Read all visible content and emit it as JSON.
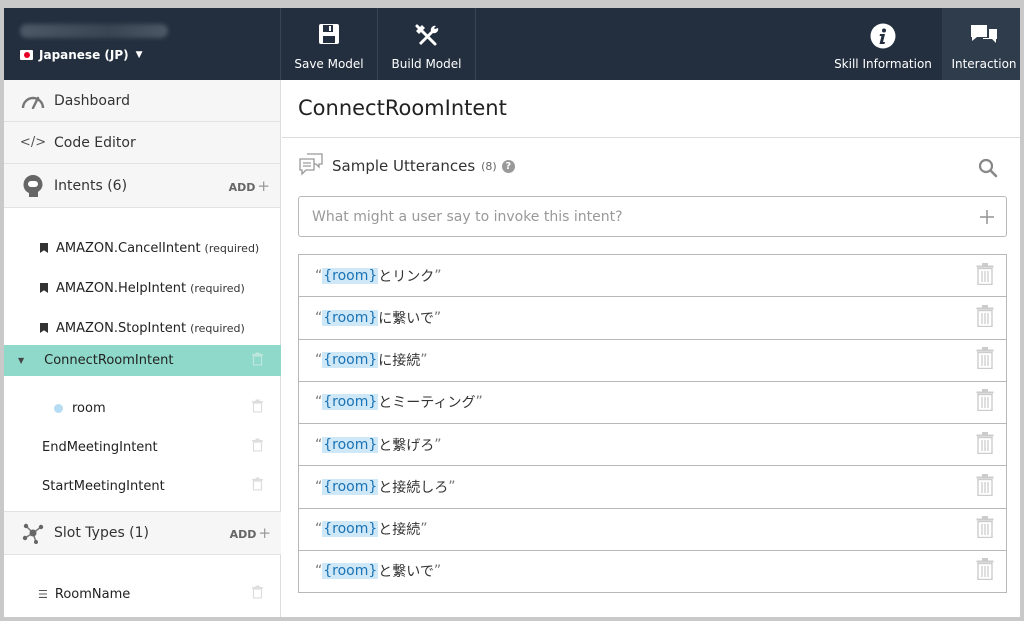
{
  "header": {
    "locale_label": "Japanese (JP)",
    "buttons": {
      "save": "Save Model",
      "build": "Build Model",
      "skill_info": "Skill Information",
      "interaction": "Interaction"
    }
  },
  "sidebar": {
    "dashboard": "Dashboard",
    "code_editor": "Code Editor",
    "intents_label": "Intents (6)",
    "add_label": "ADD",
    "builtin_intents": [
      {
        "name": "AMAZON.CancelIntent",
        "tag": "(required)"
      },
      {
        "name": "AMAZON.HelpIntent",
        "tag": "(required)"
      },
      {
        "name": "AMAZON.StopIntent",
        "tag": "(required)"
      }
    ],
    "active_intent": "ConnectRoomIntent",
    "active_slot": "room",
    "other_intents": [
      "EndMeetingIntent",
      "StartMeetingIntent"
    ],
    "slot_types_label": "Slot Types (1)",
    "slot_types": [
      "RoomName"
    ]
  },
  "main": {
    "intent_title": "ConnectRoomIntent",
    "section_label": "Sample Utterances",
    "count": "(8)",
    "help_mark": "?",
    "input_placeholder": "What might a user say to invoke this intent?",
    "slot_token": "{room}",
    "utterances": [
      " とリンク",
      " に繋いで",
      " に接続",
      " とミーティング",
      " と繋げろ",
      " と接続しろ",
      " と接続",
      " と繋いで"
    ]
  },
  "colors": {
    "topbar_bg": "#232f3e",
    "active_intent_bg": "#8ed9ca",
    "slot_highlight": "#cfe8f7"
  }
}
